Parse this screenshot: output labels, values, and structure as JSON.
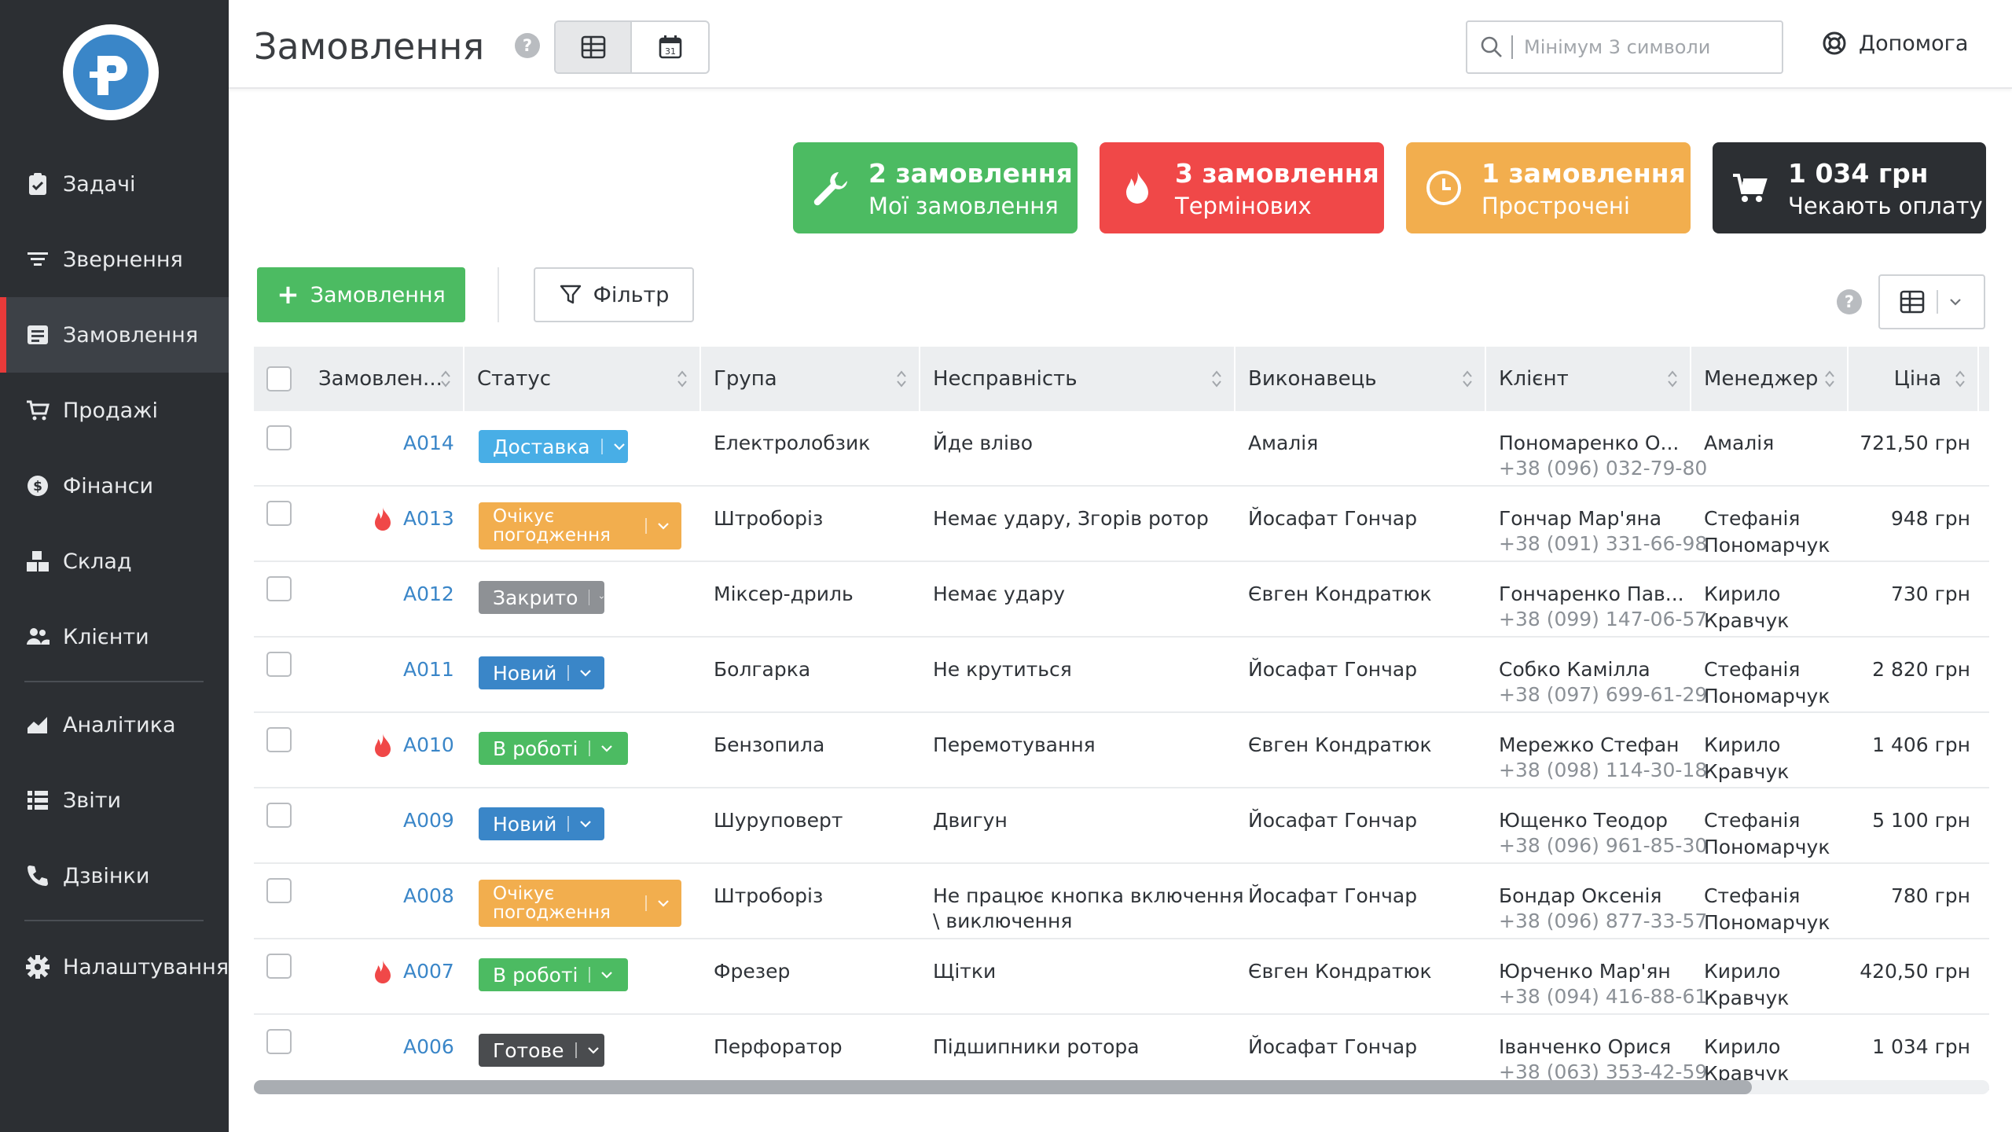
{
  "header": {
    "title": "Замовлення",
    "search_placeholder": "Мінімум 3 символи",
    "help_label": "Допомога",
    "help_q": "?"
  },
  "sidebar": {
    "items": [
      {
        "label": "Задачі"
      },
      {
        "label": "Звернення"
      },
      {
        "label": "Замовлення"
      },
      {
        "label": "Продажі"
      },
      {
        "label": "Фінанси"
      },
      {
        "label": "Склад"
      },
      {
        "label": "Клієнти"
      },
      {
        "label": "Аналітика"
      },
      {
        "label": "Звіти"
      },
      {
        "label": "Дзвінки"
      },
      {
        "label": "Налаштування"
      }
    ]
  },
  "cards": [
    {
      "title": "2 замовлення",
      "subtitle": "Мої замовлення",
      "color": "#4cbb62"
    },
    {
      "title": "3 замовлення",
      "subtitle": "Термінових",
      "color": "#f04848"
    },
    {
      "title": "1 замовлення",
      "subtitle": "Прострочені",
      "color": "#f2ae4e"
    },
    {
      "title": "1 034 грн",
      "subtitle": "Чекають оплату",
      "color": "#2c2f33"
    }
  ],
  "toolbar": {
    "add_label": "Замовлення",
    "add_plus": "+",
    "filter_label": "Фільтр"
  },
  "table": {
    "columns": [
      "Замовлен...",
      "Статус",
      "Група",
      "Несправність",
      "Виконавець",
      "Клієнт",
      "Менеджер",
      "Ціна"
    ],
    "rows": [
      {
        "id": "A014",
        "urgent": false,
        "status": "Доставка",
        "status_color": "#48aee6",
        "group": "Електролобзик",
        "fault": "Йде вліво",
        "fault2": "",
        "executor": "Амалія",
        "client": "Пономаренко О...",
        "phone": "+38 (096) 032-79-80",
        "manager": "Амалія",
        "manager2": "",
        "price": "721,50 грн"
      },
      {
        "id": "A013",
        "urgent": true,
        "status": "Очікує погодження",
        "status_color": "#f2ae4e",
        "group": "Штроборіз",
        "fault": "Немає удару, Згорів ротор",
        "fault2": "",
        "executor": "Йосафат Гончар",
        "client": "Гончар Мар'яна",
        "phone": "+38 (091) 331-66-98",
        "manager": "Стефанія",
        "manager2": "Пономарчук",
        "price": "948 грн"
      },
      {
        "id": "A012",
        "urgent": false,
        "status": "Закрито",
        "status_color": "#8e9195",
        "group": "Міксер-дриль",
        "fault": "Немає удару",
        "fault2": "",
        "executor": "Євген Кондратюк",
        "client": "Гончаренко Пав...",
        "phone": "+38 (099) 147-06-57",
        "manager": "Кирило",
        "manager2": "Кравчук",
        "price": "730 грн"
      },
      {
        "id": "A011",
        "urgent": false,
        "status": "Новий",
        "status_color": "#3a86c8",
        "group": "Болгарка",
        "fault": "Не крутиться",
        "fault2": "",
        "executor": "Йосафат Гончар",
        "client": "Собко Камілла",
        "phone": "+38 (097) 699-61-29",
        "manager": "Стефанія",
        "manager2": "Пономарчук",
        "price": "2 820 грн"
      },
      {
        "id": "A010",
        "urgent": true,
        "status": "В роботі",
        "status_color": "#4cbb62",
        "group": "Бензопила",
        "fault": "Перемотування",
        "fault2": "",
        "executor": "Євген Кондратюк",
        "client": "Мережко Стефан",
        "phone": "+38 (098) 114-30-18",
        "manager": "Кирило",
        "manager2": "Кравчук",
        "price": "1 406 грн"
      },
      {
        "id": "A009",
        "urgent": false,
        "status": "Новий",
        "status_color": "#3a86c8",
        "group": "Шуруповерт",
        "fault": "Двигун",
        "fault2": "",
        "executor": "Йосафат Гончар",
        "client": "Ющенко Теодор",
        "phone": "+38 (096) 961-85-30",
        "manager": "Стефанія",
        "manager2": "Пономарчук",
        "price": "5 100 грн"
      },
      {
        "id": "A008",
        "urgent": false,
        "status": "Очікує погодження",
        "status_color": "#f2ae4e",
        "group": "Штроборіз",
        "fault": "Не працює кнопка включення",
        "fault2": "\\ виключення",
        "executor": "Йосафат Гончар",
        "client": "Бондар Оксенія",
        "phone": "+38 (096) 877-33-57",
        "manager": "Стефанія",
        "manager2": "Пономарчук",
        "price": "780 грн"
      },
      {
        "id": "A007",
        "urgent": true,
        "status": "В роботі",
        "status_color": "#4cbb62",
        "group": "Фрезер",
        "fault": "Щітки",
        "fault2": "",
        "executor": "Євген Кондратюк",
        "client": "Юрченко Мар'ян",
        "phone": "+38 (094) 416-88-61",
        "manager": "Кирило",
        "manager2": "Кравчук",
        "price": "420,50 грн"
      },
      {
        "id": "A006",
        "urgent": false,
        "status": "Готове",
        "status_color": "#4a4c4f",
        "group": "Перфоратор",
        "fault": "Підшипники ротора",
        "fault2": "",
        "executor": "Йосафат Гончар",
        "client": "Іванченко Орися",
        "phone": "+38 (063) 353-42-59",
        "manager": "Кирило",
        "manager2": "Кравчук",
        "price": "1 034 грн"
      }
    ]
  }
}
